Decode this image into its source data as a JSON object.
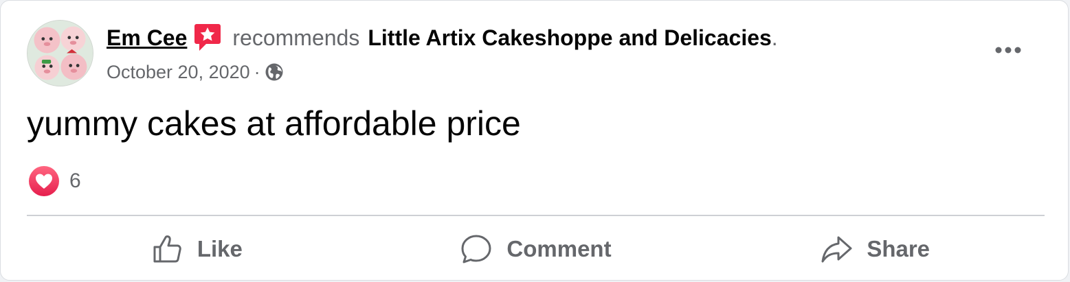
{
  "post": {
    "author": "Em Cee",
    "verb": "recommends",
    "page": "Little Artix Cakeshoppe and Delicacies",
    "period": ".",
    "date": "October 20, 2020",
    "separator": "·",
    "privacy_icon": "globe-icon",
    "text": "yummy cakes at affordable price"
  },
  "reactions": {
    "icon": "love-reaction-icon",
    "count": "6"
  },
  "actions": {
    "like": "Like",
    "comment": "Comment",
    "share": "Share"
  },
  "colors": {
    "recommend_badge": "#f02849",
    "love_reaction": "#f33e58",
    "secondary_text": "#65676b",
    "primary_text": "#050505"
  }
}
